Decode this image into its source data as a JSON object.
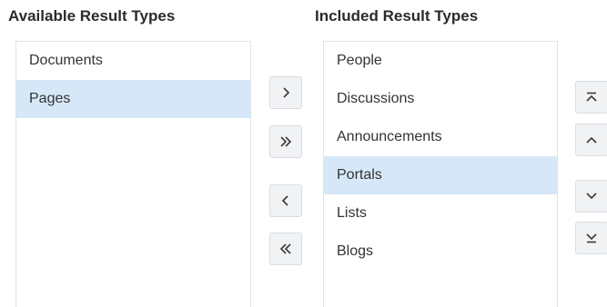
{
  "available": {
    "heading": "Available Result Types",
    "items": [
      {
        "label": "Documents",
        "selected": false
      },
      {
        "label": "Pages",
        "selected": true
      }
    ]
  },
  "included": {
    "heading": "Included Result Types",
    "items": [
      {
        "label": "People",
        "selected": false
      },
      {
        "label": "Discussions",
        "selected": false
      },
      {
        "label": "Announcements",
        "selected": false
      },
      {
        "label": "Portals",
        "selected": true
      },
      {
        "label": "Lists",
        "selected": false
      },
      {
        "label": "Blogs",
        "selected": false
      }
    ]
  },
  "transfer_buttons": {
    "move_right_icon": "chevron-right-icon",
    "move_all_right_icon": "double-chevron-right-icon",
    "move_left_icon": "chevron-left-icon",
    "move_all_left_icon": "double-chevron-left-icon"
  },
  "order_buttons": {
    "move_top_icon": "move-to-top-icon",
    "move_up_icon": "chevron-up-icon",
    "move_down_icon": "chevron-down-icon",
    "move_bottom_icon": "move-to-bottom-icon"
  },
  "colors": {
    "selected_row": "#d6e8f8",
    "list_border": "#dfe3e8",
    "button_bg": "#f0f2f4"
  }
}
